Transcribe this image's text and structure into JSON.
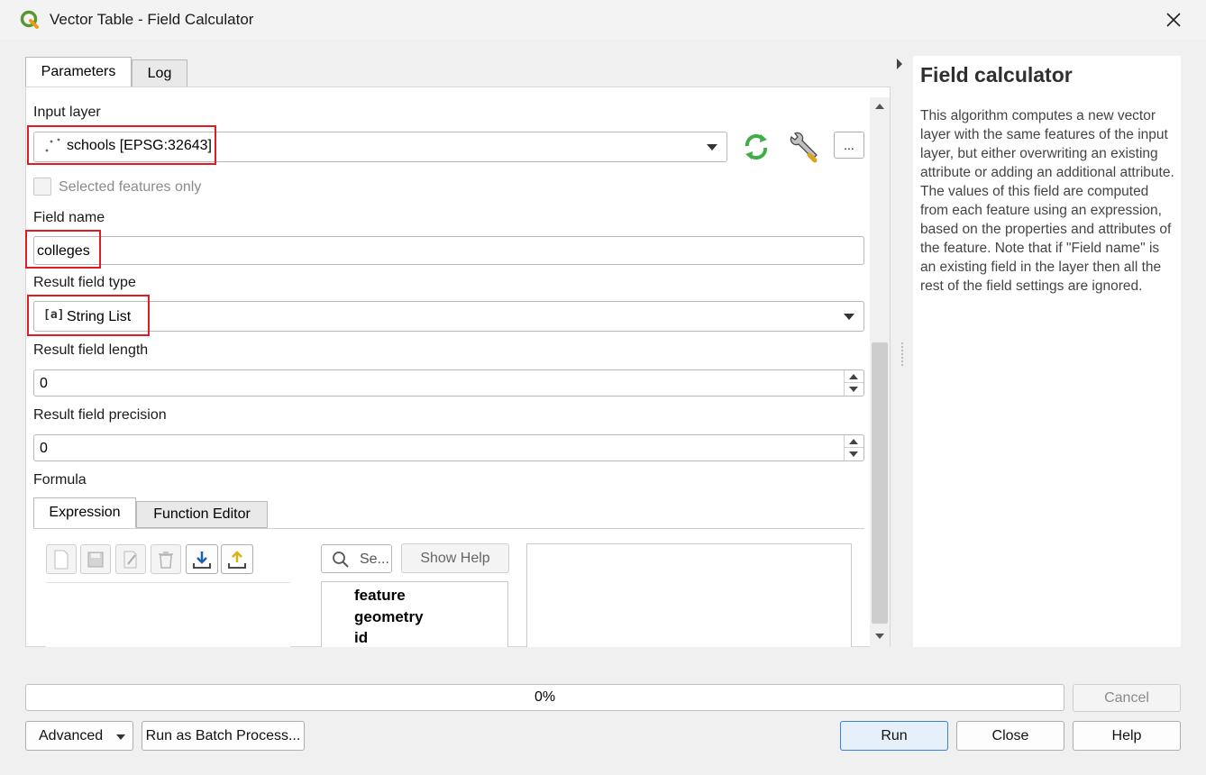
{
  "window": {
    "title": "Vector Table - Field Calculator"
  },
  "tabs": {
    "parameters": "Parameters",
    "log": "Log"
  },
  "form": {
    "input_layer_label": "Input layer",
    "input_layer_value": "schools [EPSG:32643]",
    "selected_only_label": "Selected features only",
    "field_name_label": "Field name",
    "field_name_value": "colleges",
    "result_type_label": "Result field type",
    "result_type_value": "String List",
    "result_type_icon_text": "[a]",
    "result_length_label": "Result field length",
    "result_length_value": "0",
    "result_precision_label": "Result field precision",
    "result_precision_value": "0",
    "formula_label": "Formula",
    "more_button": "..."
  },
  "formula_tabs": {
    "expression": "Expression",
    "function_editor": "Function Editor"
  },
  "expression_panel": {
    "search_placeholder": "Se...",
    "show_help": "Show Help",
    "functions": [
      "feature",
      "geometry",
      "id"
    ]
  },
  "help": {
    "title": "Field calculator",
    "body": "This algorithm computes a new vector layer with the same features of the input layer, but either overwriting an existing attribute or adding an additional attribute. The values of this field are computed from each feature using an expression, based on the properties and attributes of the feature. Note that if \"Field name\" is an existing field in the layer then all the rest of the field settings are ignored."
  },
  "footer": {
    "progress_text": "0%",
    "cancel": "Cancel",
    "advanced": "Advanced",
    "batch": "Run as Batch Process...",
    "run": "Run",
    "close": "Close",
    "help": "Help"
  },
  "colors": {
    "highlight": "#e01b24",
    "qgis_green": "#589632",
    "refresh_green": "#3fae49"
  }
}
